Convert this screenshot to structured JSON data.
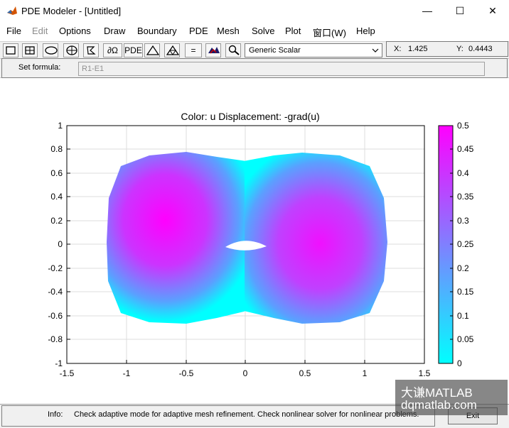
{
  "window": {
    "title": "PDE Modeler - [Untitled]",
    "minimize_glyph": "—",
    "maximize_glyph": "☐",
    "close_glyph": "✕"
  },
  "menu": [
    {
      "label": "File",
      "enabled": true
    },
    {
      "label": "Edit",
      "enabled": false
    },
    {
      "label": "Options",
      "enabled": true
    },
    {
      "label": "Draw",
      "enabled": true
    },
    {
      "label": "Boundary",
      "enabled": true
    },
    {
      "label": "PDE",
      "enabled": true
    },
    {
      "label": "Mesh",
      "enabled": true
    },
    {
      "label": "Solve",
      "enabled": true
    },
    {
      "label": "Plot",
      "enabled": true
    },
    {
      "label": "窗口(W)",
      "enabled": true
    },
    {
      "label": "Help",
      "enabled": true
    }
  ],
  "toolbar": {
    "pde_button": "PDE",
    "equals_button": "=",
    "boundary_button": "∂Ω",
    "mode_select": "Generic Scalar"
  },
  "coords": {
    "x_label": "X:",
    "x_value": "1.425",
    "y_label": "Y:",
    "y_value": "0.4443"
  },
  "formula": {
    "label": "Set formula:",
    "value": "R1-E1"
  },
  "plot": {
    "title": "Color: u  Displacement: -grad(u)"
  },
  "chart_data": {
    "type": "heatmap",
    "title": "Color: u  Displacement: -grad(u)",
    "xlim": [
      -1.5,
      1.5
    ],
    "ylim": [
      -1,
      1
    ],
    "x_ticks": [
      "-1.5",
      "-1",
      "-0.5",
      "0",
      "0.5",
      "1",
      "1.5"
    ],
    "y_ticks": [
      "-1",
      "-0.8",
      "-0.6",
      "-0.4",
      "-0.2",
      "0",
      "0.2",
      "0.4",
      "0.6",
      "0.8",
      "1"
    ],
    "colorbar_range": [
      0,
      0.5
    ],
    "colorbar_ticks": [
      "0",
      "0.05",
      "0.1",
      "0.15",
      "0.2",
      "0.25",
      "0.3",
      "0.35",
      "0.4",
      "0.45",
      "0.5"
    ],
    "colormap": [
      "#00ffff",
      "#ff00ff"
    ],
    "peaks": [
      {
        "x": -0.65,
        "y": 0.2,
        "value": 0.5
      },
      {
        "x": 0.65,
        "y": 0.0,
        "value": 0.45
      }
    ],
    "grid": true
  },
  "status": {
    "info_label": "Info:",
    "info_text": "Check adaptive mode for adaptive mesh refinement. Check nonlinear solver for nonlinear problems.",
    "exit_label": "Exit"
  },
  "watermark": {
    "line1": "大谦MATLAB",
    "line2": "dqmatlab.com"
  }
}
